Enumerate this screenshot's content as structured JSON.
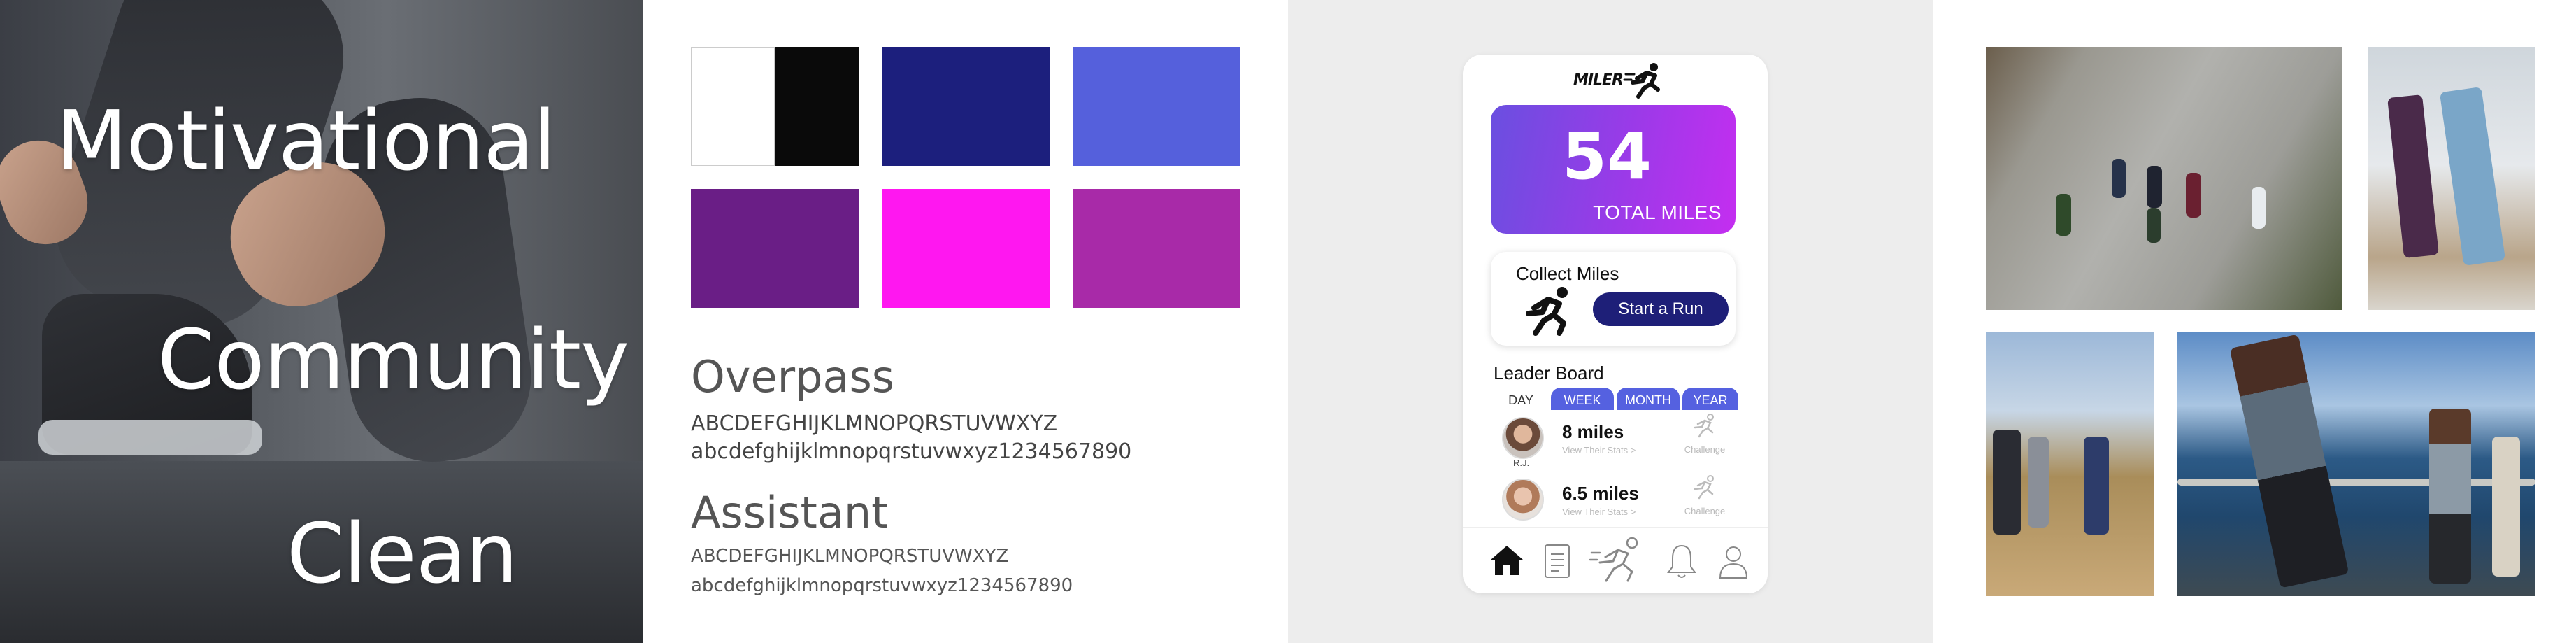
{
  "panel_words": {
    "word1": "Motivational",
    "word2": "Community",
    "word3": "Clean"
  },
  "palette": {
    "colors": [
      "#ffffff",
      "#0a0a0a",
      "#1c1f7d",
      "#5560dc",
      "#6a1e86",
      "#ff17f0",
      "#a82aa8"
    ]
  },
  "typography": {
    "font1": {
      "name": "Overpass",
      "upper": "ABCDEFGHIJKLMNOPQRSTUVWXYZ",
      "lower": "abcdefghijklmnopqrstuvwxyz1234567890"
    },
    "font2": {
      "name": "Assistant",
      "upper": "ABCDEFGHIJKLMNOPQRSTUVWXYZ",
      "lower": "abcdefghijklmnopqrstuvwxyz1234567890"
    }
  },
  "app": {
    "logo": "MILER",
    "total_miles_value": "54",
    "total_miles_label": "TOTAL MILES",
    "collect_title": "Collect Miles",
    "start_run_label": "Start a Run",
    "leaderboard_title": "Leader Board",
    "tabs": [
      "DAY",
      "WEEK",
      "MONTH",
      "YEAR"
    ],
    "rows": [
      {
        "initials": "R.J.",
        "miles": "8 miles",
        "stats": "View Their Stats >",
        "challenge": "Challenge"
      },
      {
        "initials": "",
        "miles": "6.5 miles",
        "stats": "View Their Stats >",
        "challenge": "Challenge"
      }
    ],
    "nav_icons": [
      "home-icon",
      "log-icon",
      "run-icon",
      "bell-icon",
      "profile-icon"
    ],
    "accent": "#5561e0",
    "button_color": "#1e1f78"
  }
}
